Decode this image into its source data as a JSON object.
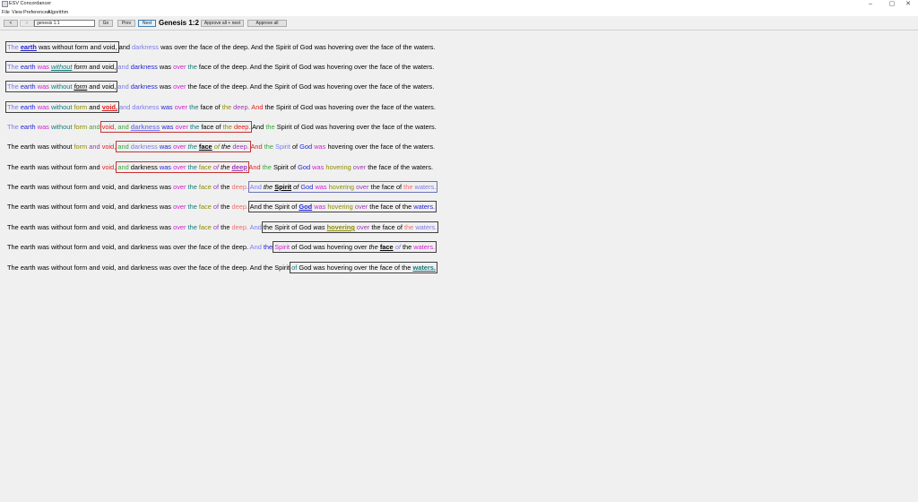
{
  "window": {
    "title": "ESV Concordancer",
    "minimize": "–",
    "maximize": "▢",
    "close": "✕"
  },
  "menu": [
    "File",
    "View",
    "Preferences",
    "Algorithm"
  ],
  "toolbar": {
    "back": "<",
    "forward": ">",
    "reference_value": "genesis 1:1",
    "go": "Go",
    "prev": "Prev",
    "next": "Next",
    "reference_title": "Genesis 1:2",
    "approve_next": "Approve all + next",
    "approve_all": "Approve all"
  },
  "colors": {
    "blue": "#1f1fd6",
    "lavender": "#7b7bea",
    "magenta": "#d21fd2",
    "teal": "#127a7a",
    "olive": "#8c8c00",
    "green": "#3aa63a",
    "red": "#e01f1f",
    "salmon": "#ee7070",
    "purple": "#9b3ab5",
    "black": "#000000",
    "highlight_box": "#404040"
  },
  "rows": [
    [
      {
        "t": "The",
        "c": "lavender",
        "g": "a"
      },
      {
        "t": "earth",
        "c": "blue",
        "b": 1,
        "u": 1,
        "g": "a"
      },
      {
        "t": "was",
        "g": "a"
      },
      {
        "t": "without",
        "g": "a"
      },
      {
        "t": "form",
        "g": "a"
      },
      {
        "t": "and",
        "g": "a"
      },
      {
        "t": "void,",
        "g": "a"
      },
      {
        "t": "and"
      },
      {
        "t": "darkness",
        "c": "lavender"
      },
      {
        "t": "was"
      },
      {
        "t": "over"
      },
      {
        "t": "the"
      },
      {
        "t": "face"
      },
      {
        "t": "of"
      },
      {
        "t": "the"
      },
      {
        "t": "deep."
      },
      {
        "t": "And"
      },
      {
        "t": "the"
      },
      {
        "t": "Spirit"
      },
      {
        "t": "of"
      },
      {
        "t": "God"
      },
      {
        "t": "was"
      },
      {
        "t": "hovering"
      },
      {
        "t": "over"
      },
      {
        "t": "the"
      },
      {
        "t": "face"
      },
      {
        "t": "of"
      },
      {
        "t": "the"
      },
      {
        "t": "waters."
      }
    ],
    [
      {
        "t": "The",
        "c": "lavender",
        "g": "a"
      },
      {
        "t": "earth",
        "c": "blue",
        "g": "a"
      },
      {
        "t": "was",
        "c": "magenta",
        "g": "a"
      },
      {
        "t": "without",
        "c": "teal",
        "i": 1,
        "u": 1,
        "g": "a"
      },
      {
        "t": "form",
        "i": 1,
        "g": "a"
      },
      {
        "t": "and",
        "g": "a"
      },
      {
        "t": "void,",
        "g": "a"
      },
      {
        "t": "and",
        "c": "lavender"
      },
      {
        "t": "darkness",
        "c": "blue"
      },
      {
        "t": "was"
      },
      {
        "t": "over",
        "c": "magenta"
      },
      {
        "t": "the",
        "c": "teal"
      },
      {
        "t": "face"
      },
      {
        "t": "of"
      },
      {
        "t": "the"
      },
      {
        "t": "deep."
      },
      {
        "t": "And"
      },
      {
        "t": "the"
      },
      {
        "t": "Spirit"
      },
      {
        "t": "of"
      },
      {
        "t": "God"
      },
      {
        "t": "was"
      },
      {
        "t": "hovering"
      },
      {
        "t": "over"
      },
      {
        "t": "the"
      },
      {
        "t": "face"
      },
      {
        "t": "of"
      },
      {
        "t": "the"
      },
      {
        "t": "waters."
      }
    ],
    [
      {
        "t": "The",
        "c": "lavender",
        "g": "a"
      },
      {
        "t": "earth",
        "c": "blue",
        "g": "a"
      },
      {
        "t": "was",
        "c": "magenta",
        "g": "a"
      },
      {
        "t": "without",
        "c": "teal",
        "g": "a"
      },
      {
        "t": "form",
        "i": 1,
        "u": 1,
        "g": "a"
      },
      {
        "t": "and",
        "g": "a"
      },
      {
        "t": "void,",
        "g": "a"
      },
      {
        "t": "and",
        "c": "lavender"
      },
      {
        "t": "darkness",
        "c": "blue"
      },
      {
        "t": "was"
      },
      {
        "t": "over",
        "c": "magenta"
      },
      {
        "t": "the"
      },
      {
        "t": "face"
      },
      {
        "t": "of"
      },
      {
        "t": "the"
      },
      {
        "t": "deep."
      },
      {
        "t": "And"
      },
      {
        "t": "the"
      },
      {
        "t": "Spirit"
      },
      {
        "t": "of"
      },
      {
        "t": "God"
      },
      {
        "t": "was"
      },
      {
        "t": "hovering"
      },
      {
        "t": "over"
      },
      {
        "t": "the"
      },
      {
        "t": "face"
      },
      {
        "t": "of"
      },
      {
        "t": "the"
      },
      {
        "t": "waters."
      }
    ],
    [
      {
        "t": "The",
        "c": "lavender",
        "g": "a"
      },
      {
        "t": "earth",
        "c": "blue",
        "g": "a"
      },
      {
        "t": "was",
        "c": "magenta",
        "g": "a"
      },
      {
        "t": "without",
        "c": "teal",
        "g": "a"
      },
      {
        "t": "form",
        "c": "olive",
        "g": "a"
      },
      {
        "t": "and",
        "g": "a"
      },
      {
        "t": "void,",
        "c": "red",
        "b": 1,
        "u": 1,
        "g": "a"
      },
      {
        "t": "and",
        "c": "lavender"
      },
      {
        "t": "darkness",
        "c": "lavender"
      },
      {
        "t": "was",
        "c": "blue"
      },
      {
        "t": "over",
        "c": "magenta"
      },
      {
        "t": "the",
        "c": "teal"
      },
      {
        "t": "face"
      },
      {
        "t": "of"
      },
      {
        "t": "the",
        "c": "olive"
      },
      {
        "t": "deep.",
        "c": "purple"
      },
      {
        "t": "And",
        "c": "red"
      },
      {
        "t": "the"
      },
      {
        "t": "Spirit"
      },
      {
        "t": "of"
      },
      {
        "t": "God"
      },
      {
        "t": "was"
      },
      {
        "t": "hovering"
      },
      {
        "t": "over"
      },
      {
        "t": "the"
      },
      {
        "t": "face"
      },
      {
        "t": "of"
      },
      {
        "t": "the"
      },
      {
        "t": "waters."
      }
    ],
    [
      {
        "t": "The",
        "c": "lavender"
      },
      {
        "t": "earth",
        "c": "blue"
      },
      {
        "t": "was",
        "c": "magenta"
      },
      {
        "t": "without",
        "c": "teal"
      },
      {
        "t": "form",
        "c": "olive"
      },
      {
        "t": "and",
        "c": "green"
      },
      {
        "t": "void,",
        "c": "red",
        "g": "r"
      },
      {
        "t": "and",
        "c": "green",
        "g": "r"
      },
      {
        "t": "darkness",
        "c": "lavender",
        "b": 1,
        "u": 1,
        "g": "r"
      },
      {
        "t": "was",
        "c": "blue",
        "g": "r"
      },
      {
        "t": "over",
        "c": "magenta",
        "g": "r"
      },
      {
        "t": "the",
        "c": "teal",
        "g": "r"
      },
      {
        "t": "face",
        "g": "r"
      },
      {
        "t": "of",
        "g": "r"
      },
      {
        "t": "the",
        "c": "olive",
        "g": "r"
      },
      {
        "t": "deep.",
        "c": "red",
        "g": "r"
      },
      {
        "t": "And"
      },
      {
        "t": "the",
        "c": "green"
      },
      {
        "t": "Spirit"
      },
      {
        "t": "of"
      },
      {
        "t": "God"
      },
      {
        "t": "was"
      },
      {
        "t": "hovering"
      },
      {
        "t": "over"
      },
      {
        "t": "the"
      },
      {
        "t": "face"
      },
      {
        "t": "of"
      },
      {
        "t": "the"
      },
      {
        "t": "waters."
      }
    ],
    [
      {
        "t": "The"
      },
      {
        "t": "earth"
      },
      {
        "t": "was"
      },
      {
        "t": "without"
      },
      {
        "t": "form",
        "c": "olive"
      },
      {
        "t": "and",
        "c": "purple"
      },
      {
        "t": "void,",
        "c": "red"
      },
      {
        "t": "and",
        "c": "green",
        "g": "r"
      },
      {
        "t": "darkness",
        "c": "lavender",
        "g": "r"
      },
      {
        "t": "was",
        "c": "blue",
        "g": "r"
      },
      {
        "t": "over",
        "c": "magenta",
        "g": "r"
      },
      {
        "t": "the",
        "c": "teal",
        "i": 1,
        "g": "r"
      },
      {
        "t": "face",
        "b": 1,
        "u": 1,
        "g": "r"
      },
      {
        "t": "of",
        "c": "olive",
        "i": 1,
        "g": "r"
      },
      {
        "t": "the",
        "i": 1,
        "g": "r"
      },
      {
        "t": "deep.",
        "c": "purple",
        "g": "r"
      },
      {
        "t": "And",
        "c": "red"
      },
      {
        "t": "the",
        "c": "green"
      },
      {
        "t": "Spirit",
        "c": "lavender"
      },
      {
        "t": "of"
      },
      {
        "t": "God",
        "c": "blue"
      },
      {
        "t": "was",
        "c": "magenta"
      },
      {
        "t": "hovering"
      },
      {
        "t": "over"
      },
      {
        "t": "the"
      },
      {
        "t": "face"
      },
      {
        "t": "of"
      },
      {
        "t": "the"
      },
      {
        "t": "waters."
      }
    ],
    [
      {
        "t": "The"
      },
      {
        "t": "earth"
      },
      {
        "t": "was"
      },
      {
        "t": "without"
      },
      {
        "t": "form"
      },
      {
        "t": "and"
      },
      {
        "t": "void,",
        "c": "red"
      },
      {
        "t": "and",
        "c": "green",
        "g": "r"
      },
      {
        "t": "darkness",
        "g": "r"
      },
      {
        "t": "was",
        "c": "blue",
        "g": "r"
      },
      {
        "t": "over",
        "c": "magenta",
        "g": "r"
      },
      {
        "t": "the",
        "c": "teal",
        "g": "r"
      },
      {
        "t": "face",
        "c": "olive",
        "g": "r"
      },
      {
        "t": "of",
        "c": "purple",
        "i": 1,
        "g": "r"
      },
      {
        "t": "the",
        "i": 1,
        "g": "r"
      },
      {
        "t": "deep",
        "c": "purple",
        "b": 1,
        "u": 1,
        "g": "r"
      },
      {
        "t": "And",
        "c": "red"
      },
      {
        "t": "the",
        "c": "green"
      },
      {
        "t": "Spirit"
      },
      {
        "t": "of"
      },
      {
        "t": "God",
        "c": "blue"
      },
      {
        "t": "was",
        "c": "magenta"
      },
      {
        "t": "hovering",
        "c": "olive"
      },
      {
        "t": "over",
        "c": "purple"
      },
      {
        "t": "the"
      },
      {
        "t": "face"
      },
      {
        "t": "of"
      },
      {
        "t": "the"
      },
      {
        "t": "waters."
      }
    ],
    [
      {
        "t": "The"
      },
      {
        "t": "earth"
      },
      {
        "t": "was"
      },
      {
        "t": "without"
      },
      {
        "t": "form"
      },
      {
        "t": "and"
      },
      {
        "t": "void,"
      },
      {
        "t": "and"
      },
      {
        "t": "darkness"
      },
      {
        "t": "was"
      },
      {
        "t": "over",
        "c": "magenta"
      },
      {
        "t": "the",
        "c": "teal"
      },
      {
        "t": "face",
        "c": "olive"
      },
      {
        "t": "of",
        "c": "purple"
      },
      {
        "t": "the"
      },
      {
        "t": "deep.",
        "c": "salmon"
      },
      {
        "t": "And",
        "c": "lavender",
        "g": "b"
      },
      {
        "t": "the",
        "i": 1,
        "g": "b"
      },
      {
        "t": "Spirit",
        "b": 1,
        "u": 1,
        "g": "b"
      },
      {
        "t": "of",
        "i": 1,
        "g": "b"
      },
      {
        "t": "God",
        "c": "blue",
        "g": "b"
      },
      {
        "t": "was",
        "c": "magenta",
        "g": "b"
      },
      {
        "t": "hovering",
        "c": "olive",
        "g": "b"
      },
      {
        "t": "over",
        "c": "purple",
        "g": "b"
      },
      {
        "t": "the",
        "g": "b"
      },
      {
        "t": "face",
        "g": "b"
      },
      {
        "t": "of",
        "g": "b"
      },
      {
        "t": "the",
        "c": "salmon",
        "g": "b"
      },
      {
        "t": "waters.",
        "c": "lavender",
        "g": "b"
      }
    ],
    [
      {
        "t": "The"
      },
      {
        "t": "earth"
      },
      {
        "t": "was"
      },
      {
        "t": "without"
      },
      {
        "t": "form"
      },
      {
        "t": "and"
      },
      {
        "t": "void,"
      },
      {
        "t": "and"
      },
      {
        "t": "darkness"
      },
      {
        "t": "was"
      },
      {
        "t": "over",
        "c": "magenta"
      },
      {
        "t": "the",
        "c": "teal"
      },
      {
        "t": "face",
        "c": "olive"
      },
      {
        "t": "of",
        "c": "purple"
      },
      {
        "t": "the"
      },
      {
        "t": "deep.",
        "c": "salmon"
      },
      {
        "t": "And",
        "g": "a"
      },
      {
        "t": "the",
        "g": "a"
      },
      {
        "t": "Spirit",
        "g": "a"
      },
      {
        "t": "of",
        "g": "a"
      },
      {
        "t": "God",
        "c": "blue",
        "b": 1,
        "u": 1,
        "g": "a"
      },
      {
        "t": "was",
        "c": "magenta",
        "g": "a"
      },
      {
        "t": "hovering",
        "c": "olive",
        "g": "a"
      },
      {
        "t": "over",
        "c": "purple",
        "g": "a"
      },
      {
        "t": "the",
        "g": "a"
      },
      {
        "t": "face",
        "g": "a"
      },
      {
        "t": "of",
        "g": "a"
      },
      {
        "t": "the",
        "g": "a"
      },
      {
        "t": "waters.",
        "c": "blue",
        "g": "a"
      }
    ],
    [
      {
        "t": "The"
      },
      {
        "t": "earth"
      },
      {
        "t": "was"
      },
      {
        "t": "without"
      },
      {
        "t": "form"
      },
      {
        "t": "and"
      },
      {
        "t": "void,"
      },
      {
        "t": "and"
      },
      {
        "t": "darkness"
      },
      {
        "t": "was"
      },
      {
        "t": "over",
        "c": "magenta"
      },
      {
        "t": "the",
        "c": "teal"
      },
      {
        "t": "face",
        "c": "olive"
      },
      {
        "t": "of",
        "c": "purple"
      },
      {
        "t": "the"
      },
      {
        "t": "deep.",
        "c": "salmon"
      },
      {
        "t": "And",
        "c": "lavender"
      },
      {
        "t": "the",
        "g": "a"
      },
      {
        "t": "Spirit",
        "g": "a"
      },
      {
        "t": "of",
        "g": "a"
      },
      {
        "t": "God",
        "g": "a"
      },
      {
        "t": "was",
        "i": 1,
        "g": "a"
      },
      {
        "t": "hovering",
        "c": "olive",
        "b": 1,
        "u": 1,
        "g": "a"
      },
      {
        "t": "over",
        "c": "purple",
        "g": "a"
      },
      {
        "t": "the",
        "g": "a"
      },
      {
        "t": "face",
        "g": "a"
      },
      {
        "t": "of",
        "g": "a"
      },
      {
        "t": "the",
        "c": "salmon",
        "g": "a"
      },
      {
        "t": "waters.",
        "c": "lavender",
        "g": "a"
      }
    ],
    [
      {
        "t": "The"
      },
      {
        "t": "earth"
      },
      {
        "t": "was"
      },
      {
        "t": "without"
      },
      {
        "t": "form"
      },
      {
        "t": "and"
      },
      {
        "t": "void,"
      },
      {
        "t": "and"
      },
      {
        "t": "darkness"
      },
      {
        "t": "was"
      },
      {
        "t": "over"
      },
      {
        "t": "the"
      },
      {
        "t": "face"
      },
      {
        "t": "of"
      },
      {
        "t": "the"
      },
      {
        "t": "deep."
      },
      {
        "t": "And",
        "c": "lavender"
      },
      {
        "t": "the",
        "c": "blue"
      },
      {
        "t": "Spirit",
        "c": "magenta",
        "g": "a"
      },
      {
        "t": "of",
        "g": "a"
      },
      {
        "t": "God",
        "g": "a"
      },
      {
        "t": "was",
        "g": "a"
      },
      {
        "t": "hovering",
        "g": "a"
      },
      {
        "t": "over",
        "g": "a"
      },
      {
        "t": "the",
        "i": 1,
        "g": "a"
      },
      {
        "t": "face",
        "b": 1,
        "u": 1,
        "g": "a"
      },
      {
        "t": "of",
        "c": "lavender",
        "i": 1,
        "g": "a"
      },
      {
        "t": "the",
        "g": "a"
      },
      {
        "t": "waters.",
        "c": "magenta",
        "g": "a"
      }
    ],
    [
      {
        "t": "The"
      },
      {
        "t": "earth"
      },
      {
        "t": "was"
      },
      {
        "t": "without"
      },
      {
        "t": "form"
      },
      {
        "t": "and"
      },
      {
        "t": "void,"
      },
      {
        "t": "and"
      },
      {
        "t": "darkness"
      },
      {
        "t": "was"
      },
      {
        "t": "over"
      },
      {
        "t": "the"
      },
      {
        "t": "face"
      },
      {
        "t": "of"
      },
      {
        "t": "the"
      },
      {
        "t": "deep."
      },
      {
        "t": "And"
      },
      {
        "t": "the"
      },
      {
        "t": "Spirit"
      },
      {
        "t": "of",
        "c": "teal",
        "g": "a"
      },
      {
        "t": "God",
        "g": "a"
      },
      {
        "t": "was",
        "g": "a"
      },
      {
        "t": "hovering",
        "g": "a"
      },
      {
        "t": "over",
        "g": "a"
      },
      {
        "t": "the",
        "g": "a"
      },
      {
        "t": "face",
        "g": "a"
      },
      {
        "t": "of",
        "g": "a"
      },
      {
        "t": "the",
        "g": "a"
      },
      {
        "t": "waters.",
        "c": "teal",
        "b": 1,
        "u": 1,
        "g": "a"
      }
    ]
  ]
}
